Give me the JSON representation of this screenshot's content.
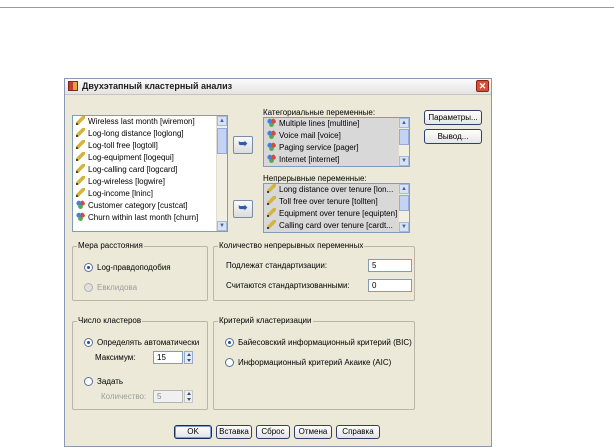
{
  "dialog": {
    "title": "Двухэтапный кластерный анализ"
  },
  "source_variables": [
    {
      "label": "Wireless last month [wiremon]",
      "icon": "pencil-icon"
    },
    {
      "label": "Log-long distance [loglong]",
      "icon": "pencil-icon"
    },
    {
      "label": "Log-toll free [logtoll]",
      "icon": "pencil-icon"
    },
    {
      "label": "Log-equipment [logequi]",
      "icon": "pencil-icon"
    },
    {
      "label": "Log-calling card [logcard]",
      "icon": "pencil-icon"
    },
    {
      "label": "Log-wireless [logwire]",
      "icon": "pencil-icon"
    },
    {
      "label": "Log-income [lninc]",
      "icon": "pencil-icon"
    },
    {
      "label": "Customer category [custcat]",
      "icon": "category-icon"
    },
    {
      "label": "Churn within last month [churn]",
      "icon": "category-icon"
    }
  ],
  "categorical": {
    "label": "Категориальные переменные:",
    "items": [
      {
        "label": "Multiple lines [multline]",
        "icon": "category-icon"
      },
      {
        "label": "Voice mail [voice]",
        "icon": "category-icon"
      },
      {
        "label": "Paging service [pager]",
        "icon": "category-icon"
      },
      {
        "label": "Internet [internet]",
        "icon": "category-icon"
      }
    ]
  },
  "continuous": {
    "label": "Непрерывные переменные:",
    "items": [
      {
        "label": "Long distance over tenure [lon...",
        "icon": "pencil-icon"
      },
      {
        "label": "Toll free over tenure [tollten]",
        "icon": "pencil-icon"
      },
      {
        "label": "Equipment over tenure [equipten]",
        "icon": "pencil-icon"
      },
      {
        "label": "Calling card over tenure [cardt...",
        "icon": "pencil-icon"
      }
    ]
  },
  "side_buttons": {
    "options": "Параметры...",
    "output": "Вывод..."
  },
  "distance": {
    "title": "Мера расстояния",
    "loglik": "Log-правдоподобия",
    "euclid": "Евклидова"
  },
  "cont_count": {
    "title": "Количество непрерывных переменных",
    "standardize_label": "Подлежат стандартизации:",
    "standardize_value": "5",
    "assumed_label": "Считаются стандартизованными:",
    "assumed_value": "0"
  },
  "clusters": {
    "title": "Число кластеров",
    "auto": "Определять автоматически",
    "max_label": "Максимум:",
    "max_value": "15",
    "specify": "Задать",
    "count_label": "Количество:",
    "count_value": "5"
  },
  "criterion": {
    "title": "Критерий кластеризации",
    "bic": "Байесовский информационный критерий (BIC)",
    "aic": "Информационный критерий Акаике (AIC)"
  },
  "buttons": {
    "ok": "OK",
    "paste": "Вставка",
    "reset": "Сброс",
    "cancel": "Отмена",
    "help": "Справка"
  }
}
